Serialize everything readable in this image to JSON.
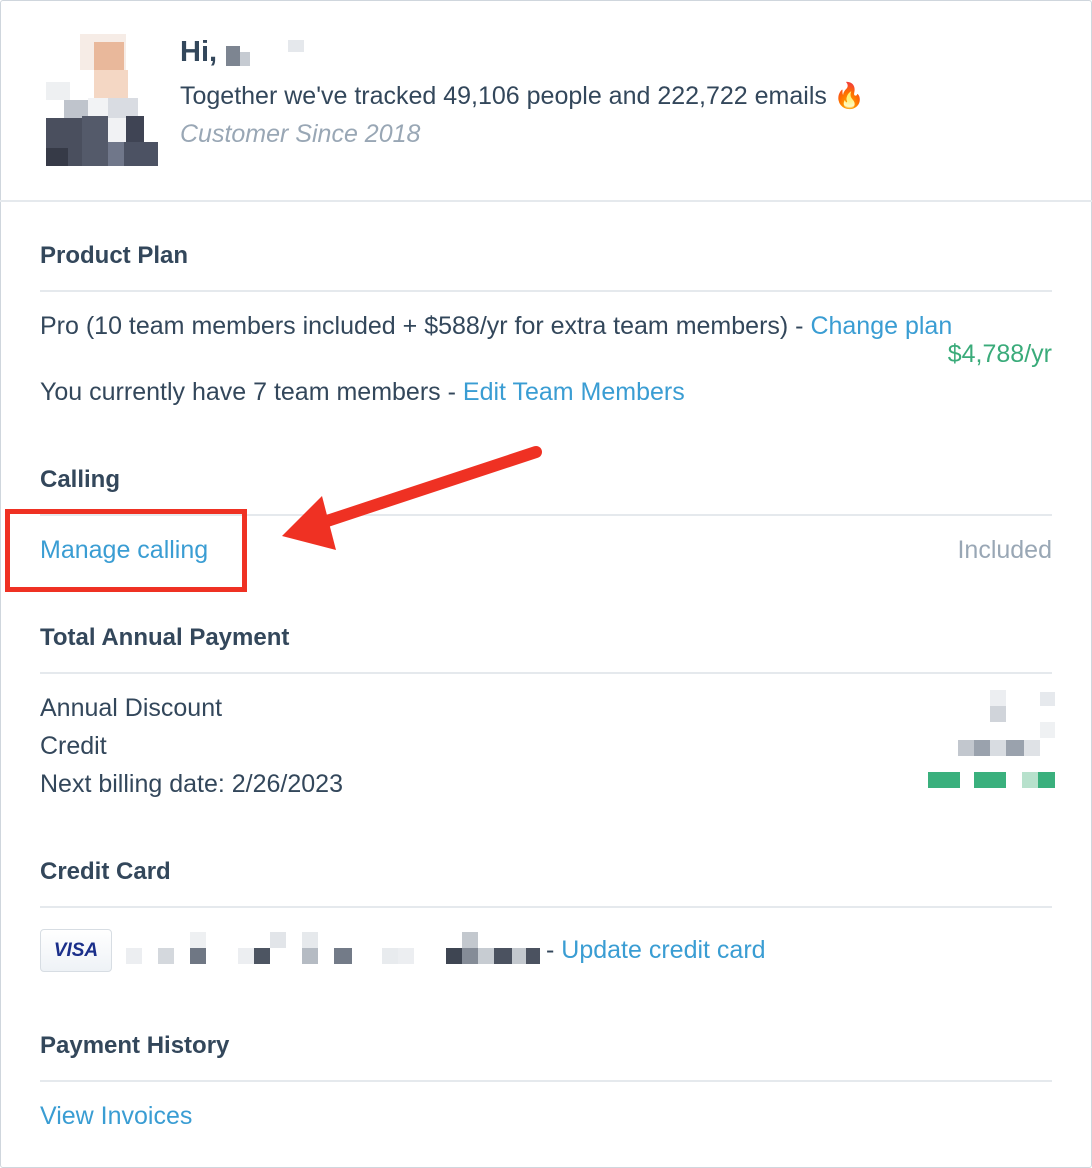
{
  "header": {
    "greeting": "Hi,",
    "tracked_text": "Together we've tracked 49,106 people and 222,722 emails 🔥",
    "customer_since": "Customer Since 2018"
  },
  "product_plan": {
    "title": "Product Plan",
    "plan_text": "Pro (10 team members included + $588/yr for extra team members) - ",
    "change_plan_link": "Change plan",
    "price": "$4,788/yr",
    "team_text": "You currently have 7 team members - ",
    "edit_team_link": "Edit Team Members"
  },
  "calling": {
    "title": "Calling",
    "manage_link": "Manage calling",
    "status": "Included"
  },
  "total_annual_payment": {
    "title": "Total Annual Payment",
    "annual_discount_label": "Annual Discount",
    "credit_label": "Credit",
    "next_billing_label": "Next billing date: 2/26/2023"
  },
  "credit_card": {
    "title": "Credit Card",
    "card_brand": "VISA",
    "separator": "- ",
    "update_link": "Update credit card"
  },
  "payment_history": {
    "title": "Payment History",
    "view_invoices_link": "View Invoices"
  },
  "colors": {
    "text": "#33475b",
    "link": "#3a9dd3",
    "price": "#3aab7a",
    "muted": "#99a7b5",
    "annotation": "#ef3123"
  },
  "icons": [
    "avatar-image",
    "fire-emoji",
    "visa-card-icon",
    "annotation-arrow-icon"
  ]
}
